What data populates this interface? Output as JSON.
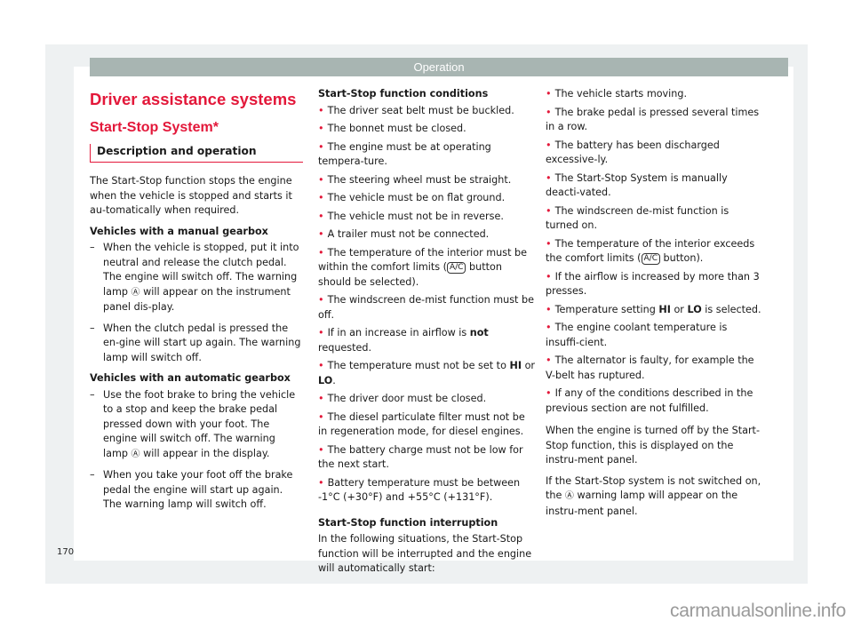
{
  "header": {
    "section": "Operation"
  },
  "col1": {
    "title": "Driver assistance systems",
    "subtitle": "Start-Stop System*",
    "section_heading": "Description and operation",
    "intro": "The Start-Stop function stops the engine when the vehicle is stopped and starts it au-tomatically when required.",
    "manual": {
      "heading": "Vehicles with a manual gearbox",
      "items": [
        {
          "before": "When the vehicle is stopped, put it into neutral and release the clutch pedal. The engine will switch off. The warning lamp ",
          "icon": "Ⓐ",
          "after": " will appear on the instrument panel dis-play."
        },
        {
          "before": "When the clutch pedal is pressed the en-gine will start up again. The warning lamp will switch off.",
          "icon": "",
          "after": ""
        }
      ]
    },
    "automatic": {
      "heading": "Vehicles with an automatic gearbox",
      "items": [
        {
          "before": "Use the foot brake to bring the vehicle to a stop and keep the brake pedal pressed down with your foot. The engine will switch off. The warning lamp ",
          "icon": "Ⓐ",
          "after": " will appear in the display."
        },
        {
          "before": "When you take your foot off the brake pedal the engine will start up again. The warning lamp will switch off.",
          "icon": "",
          "after": ""
        }
      ]
    }
  },
  "col2": {
    "conditions_heading": "Start-Stop function conditions",
    "conditions": [
      "The driver seat belt must be buckled.",
      "The bonnet must be closed.",
      "The engine must be at operating tempera-ture.",
      "The steering wheel must be straight.",
      "The vehicle must be on flat ground.",
      "The vehicle must not be in reverse.",
      "A trailer must not be connected."
    ],
    "ac_item": {
      "before": "The temperature of the interior must be within the comfort limits (",
      "key": "A/C",
      "after": " button should be selected)."
    },
    "demist": "The windscreen de-mist function must be off.",
    "airflow": {
      "before": "If in an increase in airflow is ",
      "bold": "not",
      "after": " requested."
    },
    "temp_setting": {
      "before": "The temperature must not be set to ",
      "hi": "HI",
      "mid": " or ",
      "lo": "LO",
      "after": "."
    },
    "conditions_rest": [
      "The driver door must be closed.",
      "The diesel particulate filter must not be in regeneration mode, for diesel engines.",
      "The battery charge must not be low for the next start.",
      "Battery temperature must be between -1°C (+30°F) and +55°C (+131°F)."
    ],
    "interruption_heading": "Start-Stop function interruption",
    "interruption_intro": "In the following situations, the Start-Stop function will be interrupted and the engine will automatically start:"
  },
  "col3": {
    "items_a": [
      "The vehicle starts moving.",
      "The brake pedal is pressed several times in a row.",
      "The battery has been discharged excessive-ly.",
      "The Start-Stop System is manually deacti-vated.",
      "The windscreen de-mist function is turned on."
    ],
    "ac_item": {
      "before": "The temperature of the interior exceeds the comfort limits (",
      "key": "A/C",
      "after": " button)."
    },
    "airflow": "If the airflow is increased by more than 3 presses.",
    "temp_setting": {
      "before": "Temperature setting ",
      "hi": "HI",
      "mid": " or ",
      "lo": "LO",
      "after": " is selected."
    },
    "items_b": [
      "The engine coolant temperature is insuffi-cient.",
      "The alternator is faulty, for example the V-belt has ruptured.",
      "If any of the conditions described in the previous section are not fulfilled."
    ],
    "para1": "When the engine is turned off by the Start-Stop function, this is displayed on the instru-ment panel.",
    "para2": {
      "before": "If the Start-Stop system is not switched on, the ",
      "icon": "Ⓐ",
      "after": " warning lamp will appear on the instru-ment panel."
    }
  },
  "footer": {
    "page_number": "170"
  },
  "watermark": "carmanualsonline.info",
  "bullet_glyph": "•",
  "dash_glyph": "–",
  "colors": {
    "accent": "#e3183a",
    "header_bar": "#a8b5b2",
    "frame": "#eef1f2"
  }
}
